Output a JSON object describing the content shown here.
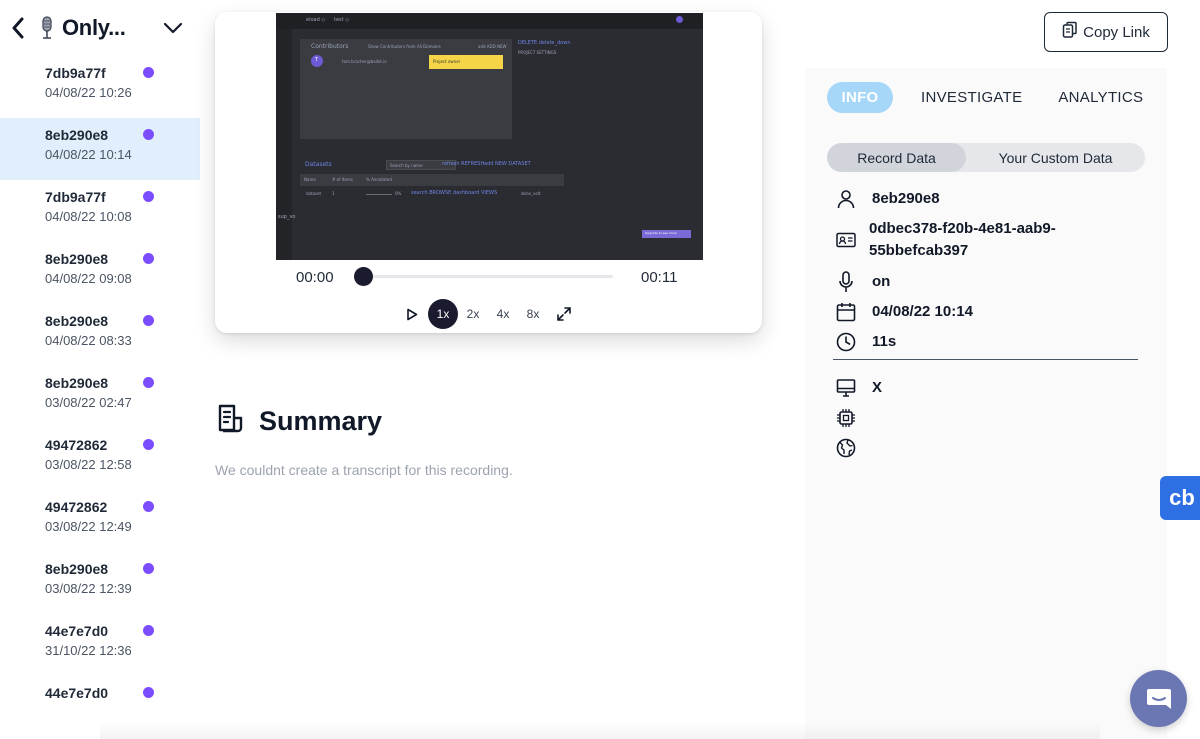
{
  "sidebar": {
    "title": "Only...",
    "icons": {
      "back": "chevron-left-icon",
      "app": "microphone-icon",
      "toggle": "chevron-down-icon"
    },
    "dot_color": "#7c4dff",
    "active_color": "#e0effb",
    "recordings": [
      {
        "id": "7db9a77f",
        "date": "04/08/22 10:26"
      },
      {
        "id": "8eb290e8",
        "date": "04/08/22 10:14"
      },
      {
        "id": "7db9a77f",
        "date": "04/08/22 10:08"
      },
      {
        "id": "8eb290e8",
        "date": "04/08/22 09:08"
      },
      {
        "id": "8eb290e8",
        "date": "04/08/22 08:33"
      },
      {
        "id": "8eb290e8",
        "date": "03/08/22 02:47"
      },
      {
        "id": "49472862",
        "date": "03/08/22 12:58"
      },
      {
        "id": "49472862",
        "date": "03/08/22 12:49"
      },
      {
        "id": "8eb290e8",
        "date": "03/08/22 12:39"
      },
      {
        "id": "44e7e7d0",
        "date": "31/10/22 12:36"
      },
      {
        "id": "44e7e7d0",
        "date": ""
      }
    ],
    "active_index": 1
  },
  "video": {
    "top_tabs": [
      "eload ◇",
      "test ◇"
    ],
    "contributors_label": "Contributors",
    "show_contributors": "Show Contributors from All Domains",
    "add_new": "add ADD NEW",
    "user_initial": "T",
    "user_email": "tom.bracher@ballot.io",
    "project_owner": "Project owner",
    "delete_link": "DELETE delete_down",
    "project_settings": "PROJECT SETTINGS",
    "datasets_label": "Datasets",
    "search_placeholder": "Search by name",
    "refresh": "refresh REFRESH",
    "new_dataset": "add NEW DATASET",
    "columns": [
      "Name",
      "# of Items",
      "% Annotated"
    ],
    "row_name": "dataset",
    "row_count": "1",
    "row_pct": "0%",
    "row_actions": "search BROWSE dashboard VIEWS",
    "row_extra": "done_volt",
    "bottom_button": "Upgrade to see more",
    "side_label": "sup_vo"
  },
  "player": {
    "current_time": "00:00",
    "duration": "00:11",
    "progress_fraction": 0,
    "speeds": [
      "1x",
      "2x",
      "4x",
      "8x"
    ],
    "active_speed": "1x",
    "icons": {
      "play": "play-icon",
      "fullscreen": "expand-icon"
    }
  },
  "summary": {
    "title": "Summary",
    "icon": "document-icon",
    "text": "We couldnt create a transcript for this recording."
  },
  "header": {
    "copy_link": "Copy Link",
    "copy_icon": "clipboard-icon"
  },
  "tabs": {
    "items": [
      "INFO",
      "INVESTIGATE",
      "ANALYTICS"
    ],
    "active": "INFO",
    "accent": "#a6d6f8"
  },
  "segments": {
    "items": [
      "Record Data",
      "Your Custom Data"
    ],
    "active": "Record Data"
  },
  "info": {
    "user": "8eb290e8",
    "session_id": "0dbec378-f20b-4e81-aab9-55bbefcab397",
    "microphone": "on",
    "date": "04/08/22 10:14",
    "duration": "11s",
    "os": "X",
    "cpu": "",
    "browser": "",
    "icons": [
      "user-icon",
      "id-card-icon",
      "microphone-icon",
      "calendar-icon",
      "clock-icon",
      "monitor-icon",
      "cpu-icon",
      "globe-icon"
    ]
  },
  "floating": {
    "cb_label": "cb",
    "cb_color": "#2f6fe4",
    "chat_icon": "chat-icon",
    "chat_color": "#6b77b3"
  }
}
